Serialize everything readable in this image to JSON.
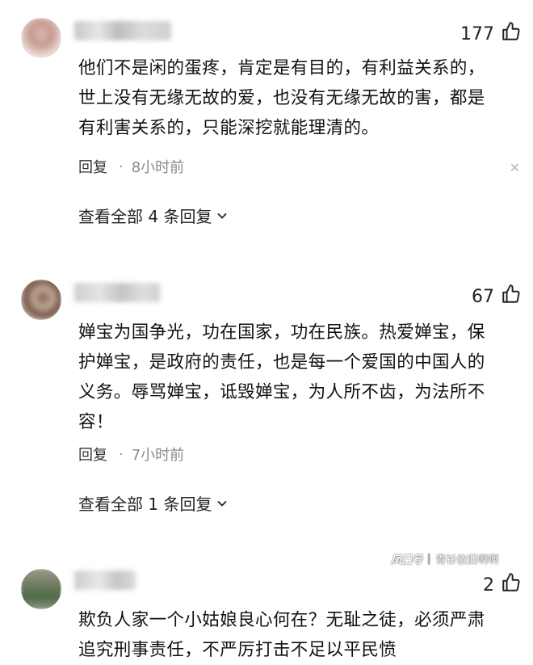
{
  "comments": [
    {
      "likes": "177",
      "text": "他们不是闲的蛋疼，肯定是有目的，有利益关系的，\n世上没有无缘无故的爱，也没有无缘无故的害，都是\n有利害关系的，只能深挖就能理清的。",
      "reply_label": "回复",
      "time": "8小时前",
      "view_replies": "查看全部 4 条回复"
    },
    {
      "likes": "67",
      "text": "婵宝为国争光，功在国家，功在民族。热爱婵宝，保\n护婵宝，是政府的责任，也是每一个爱国的中国人的\n义务。辱骂婵宝，诋毁婵宝，为人所不齿，为法所不\n容！",
      "reply_label": "回复",
      "time": "7小时前",
      "view_replies": "查看全部 1 条回复"
    },
    {
      "likes": "2",
      "text": "欺负人家一个小姑娘良心何在？无耻之徒，必须严肃\n追究刑事责任，不严厉打击不足以平民愤"
    }
  ],
  "watermark": {
    "brand": "凤凰号",
    "separator": "|",
    "author": "青衫依旧啊啊"
  },
  "colors": {
    "text": "#111111",
    "meta_time": "#8a8a8a",
    "close": "#b5b5b5"
  },
  "icons": [
    "thumbs-up-icon",
    "close-icon",
    "chevron-down-icon"
  ]
}
